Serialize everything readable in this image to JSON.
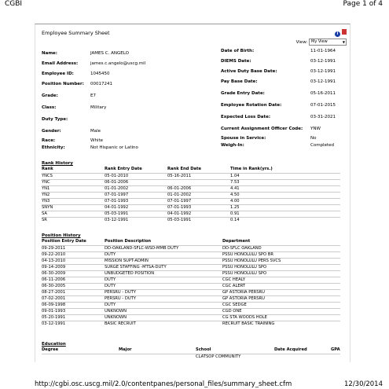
{
  "top": {
    "left": "CGBI",
    "right": "Page 1 of 4"
  },
  "header": {
    "title": "Employee Summary Sheet",
    "view_label": "View:",
    "view_value": "My View"
  },
  "info_left": [
    {
      "label": "Name:",
      "value": "JAMES C. ANGELO"
    },
    {
      "label": "Email Address:",
      "value": "james.c.angelo@uscg.mil"
    },
    {
      "label": "Employee ID:",
      "value": "1045450"
    },
    {
      "label": "Position Number:",
      "value": "00017241"
    },
    {
      "label": "Grade:",
      "value": "E7"
    },
    {
      "label": "Class:",
      "value": "Military"
    },
    {
      "label": "Duty Type:",
      "value": ""
    },
    {
      "label": "Gender:",
      "value": "Male"
    },
    {
      "label": "Race:",
      "value": "White"
    },
    {
      "label": "Ethnicity:",
      "value": "Not Hispanic or Latino"
    }
  ],
  "info_right": [
    {
      "label": "Date of Birth:",
      "value": "11-01-1964"
    },
    {
      "label": "DIEMS Date:",
      "value": "03-12-1991"
    },
    {
      "label": "Active Duty Base Date:",
      "value": "03-12-1991"
    },
    {
      "label": "Pay Base Date:",
      "value": "03-12-1991"
    },
    {
      "label": "Grade Entry Date:",
      "value": "05-16-2011"
    },
    {
      "label": "Employee Rotation Date:",
      "value": "07-01-2015"
    },
    {
      "label": "Expected Loss Date:",
      "value": "03-31-2021"
    },
    {
      "label": "Current Assignment Officer Code:",
      "value": "YNW"
    },
    {
      "label": "Spouse in Service:",
      "value": "No"
    },
    {
      "label": "Weigh-In:",
      "value": "Completed"
    }
  ],
  "rank_history": {
    "title": "Rank History",
    "headers": [
      "Rank",
      "Rank Entry Date",
      "Rank End Date",
      "Time in Rank(yrs.)"
    ],
    "rows": [
      [
        "YNCS",
        "05-01-2010",
        "05-16-2011",
        "1.04"
      ],
      [
        "YNC",
        "06-01-2006",
        "",
        "7.53"
      ],
      [
        "YN1",
        "01-01-2002",
        "06-01-2006",
        "4.41"
      ],
      [
        "YN2",
        "07-01-1997",
        "01-01-2002",
        "4.50"
      ],
      [
        "YN3",
        "07-01-1993",
        "07-01-1997",
        "4.00"
      ],
      [
        "SNYN",
        "04-01-1992",
        "07-01-1993",
        "1.25"
      ],
      [
        "SA",
        "05-03-1991",
        "04-01-1992",
        "0.91"
      ],
      [
        "SR",
        "03-12-1991",
        "05-03-1991",
        "0.14"
      ]
    ]
  },
  "position_history": {
    "title": "Position History",
    "headers": [
      "Position Entry Date",
      "Position Description",
      "",
      "Department"
    ],
    "rows": [
      [
        "09-29-2011",
        "DD-OAKLAND-SFLC-WSD-MMB DUTY",
        "",
        "DD-SFLC OAKLAND"
      ],
      [
        "09-22-2010",
        "DUTY",
        "",
        "PSSU HONOLULU SPO BR"
      ],
      [
        "04-13-2010",
        "MISSION SUPT-ADMIN",
        "",
        "PSSU HONOLULU PERS SVCS"
      ],
      [
        "09-14-2009",
        "SURGE STAFFING -MTSA-DUTY",
        "",
        "PSSU HONOLULU SPO"
      ],
      [
        "06-30-2009",
        "UNBUDGETED POSITION",
        "",
        "PSSU HONOLULU SPO"
      ],
      [
        "06-11-2006",
        "DUTY",
        "",
        "CGC HEALY"
      ],
      [
        "06-30-2005",
        "DUTY",
        "",
        "CGC ALERT"
      ],
      [
        "08-27-2001",
        "PERSRU - DUTY",
        "",
        "GP ASTORIA PERSRU"
      ],
      [
        "07-02-2001",
        "PERSRU - DUTY",
        "",
        "GP ASTORIA PERSRU"
      ],
      [
        "06-09-1998",
        "DUTY",
        "",
        "CGC SEDGE"
      ],
      [
        "09-01-1993",
        "UNKNOWN",
        "",
        "CGD ONE"
      ],
      [
        "05-20-1991",
        "UNKNOWN",
        "",
        "CG STA WOODS HOLE"
      ],
      [
        "03-12-1991",
        "BASIC RECRUIT",
        "",
        "RECRUIT BASIC TRAINING"
      ]
    ]
  },
  "education": {
    "title": "Education",
    "headers": [
      "Degree",
      "Major",
      "School",
      "Date Acquired",
      "GPA"
    ],
    "rows": [
      [
        "",
        "",
        "CLATSOP COMMUNITY",
        "",
        ""
      ]
    ]
  },
  "footer": {
    "url": "http://cgbi.osc.uscg.mil/2.0/contentpanes/personal_files/summary_sheet.cfm",
    "date": "12/30/2014"
  }
}
